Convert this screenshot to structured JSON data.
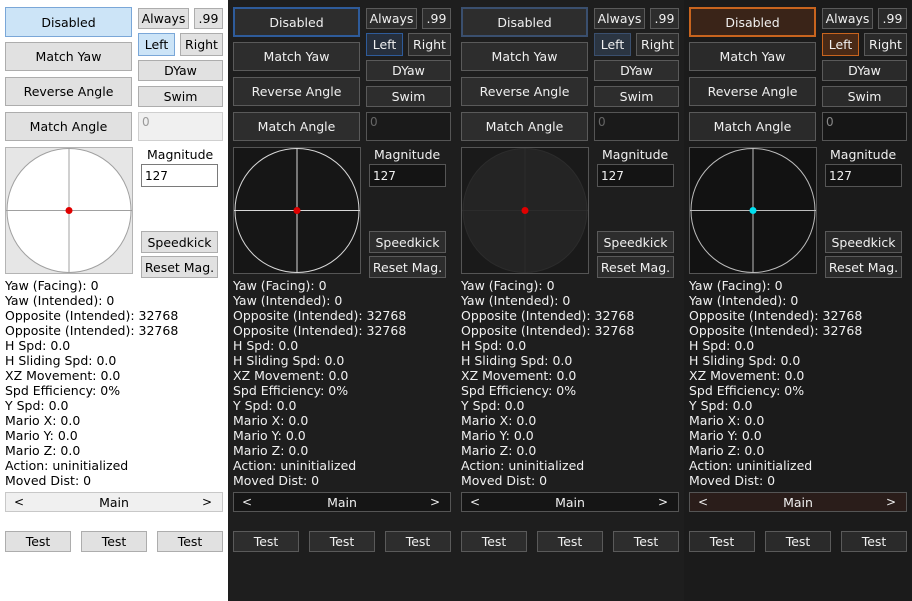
{
  "labels": {
    "disabled": "Disabled",
    "always": "Always",
    "ninety_nine": ".99",
    "left": "Left",
    "right": "Right",
    "match_yaw": "Match Yaw",
    "dyaw": "DYaw",
    "reverse_angle": "Reverse Angle",
    "swim": "Swim",
    "match_angle": "Match Angle",
    "angle_value": "0",
    "magnitude": "Magnitude",
    "magnitude_value": "127",
    "speedkick": "Speedkick",
    "reset_mag": "Reset Mag.",
    "tab_main": "Main",
    "scroll_left": "<",
    "scroll_right": ">",
    "test": "Test"
  },
  "stats": [
    "Yaw (Facing): 0",
    "Yaw (Intended): 0",
    "Opposite (Intended): 32768",
    "Opposite (Intended): 32768",
    "H Spd: 0.0",
    "H Sliding Spd: 0.0",
    "XZ Movement: 0.0",
    "Spd Efficiency: 0%",
    "Y Spd: 0.0",
    "Mario X: 0.0",
    "Mario Y: 0.0",
    "Mario Z: 0.0",
    "Action: uninitialized",
    "Moved Dist: 0"
  ],
  "themes": [
    {
      "id": "light",
      "panel_bg": "#ffffff",
      "accent": "#7aa7d8",
      "dot": "#e00000",
      "ring": "#ffffff",
      "cross": "#a0a0a0"
    },
    {
      "id": "dark-blue",
      "panel_bg": "#1e1e1e",
      "btn_bg": "#2d2d2d",
      "field_bg": "#141414",
      "accent": "#2e5b9a",
      "sel_bg": "#262f3d",
      "joy_bg": "#161616",
      "ring": "#d8d8d8",
      "cross": "#d8d8d8",
      "dot": "#e00000",
      "scroll_bg": "#151515"
    },
    {
      "id": "dark-gray",
      "panel_bg": "#1e1e1e",
      "btn_bg": "#2d2d2d",
      "field_bg": "#141414",
      "accent": "#3a4f6e",
      "sel_bg": "#2b3542",
      "joy_bg": "#1a1a1a",
      "ring": "#2c2c2c",
      "cross": "#2c2c2c",
      "dot": "#e00000",
      "scroll_bg": "#151515"
    },
    {
      "id": "dark-orange",
      "panel_bg": "#1b1b1b",
      "btn_bg": "#2a2a2a",
      "field_bg": "#141414",
      "accent": "#c8641e",
      "sel_bg": "#4a2a16",
      "sel2_bg": "#3a2418",
      "joy_bg": "#121212",
      "ring": "#bcbcbc",
      "cross": "#bcbcbc",
      "dot": "#00e0f0",
      "scroll_bg": "#2a1d1a"
    }
  ]
}
